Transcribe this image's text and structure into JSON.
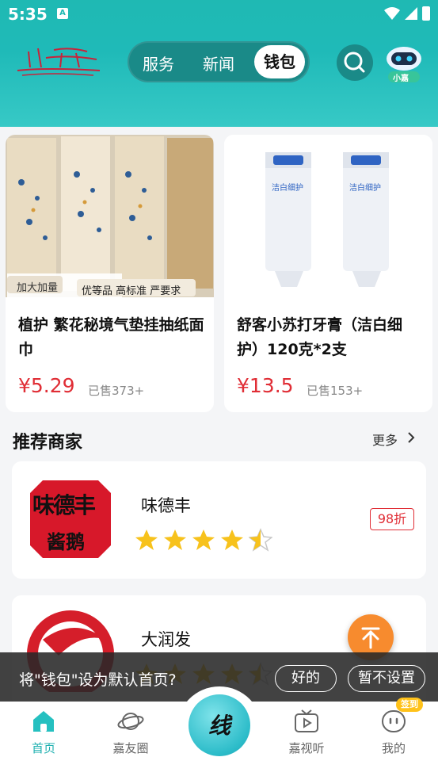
{
  "status_bar": {
    "time": "5:35",
    "notif_letter": "A"
  },
  "header": {
    "logo_text": "佳嘉",
    "tabs": [
      {
        "label": "服务"
      },
      {
        "label": "新闻"
      },
      {
        "label": "钱包"
      }
    ],
    "assistant_label": "小嘉"
  },
  "products": [
    {
      "title": "植护 繁花秘境气垫挂抽纸面巾",
      "price": "¥5.29",
      "sold": "已售373+",
      "image_tags": [
        "加大加量",
        "优等品 高标准 严要求"
      ]
    },
    {
      "title": "舒客小苏打牙膏（洁白细护）120克*2支",
      "price": "¥13.5",
      "sold": "已售153+",
      "image_tags": [
        "洁白细护"
      ]
    }
  ],
  "section": {
    "title": "推荐商家",
    "more": "更多"
  },
  "merchants": [
    {
      "name": "味德丰",
      "rating": 4.5,
      "discount": "98折",
      "logo_text_top": "味德丰",
      "logo_text_bottom": "酱鹅"
    },
    {
      "name": "大润发",
      "rating": 4.5
    }
  ],
  "toast": {
    "message": "将\"钱包\"设为默认首页?",
    "ok": "好的",
    "cancel": "暂不设置"
  },
  "bottom_nav": [
    {
      "label": "首页",
      "icon": "home-icon",
      "active": true
    },
    {
      "label": "嘉友圈",
      "icon": "planet-icon"
    },
    {
      "label": "线",
      "icon": "center-logo"
    },
    {
      "label": "嘉视听",
      "icon": "tv-icon"
    },
    {
      "label": "我的",
      "icon": "face-icon"
    }
  ],
  "sign_badge": "签到",
  "colors": {
    "accent": "#1fb9b3",
    "price": "#e02d35",
    "fab": "#f78b2e",
    "star": "#f7c21c"
  }
}
